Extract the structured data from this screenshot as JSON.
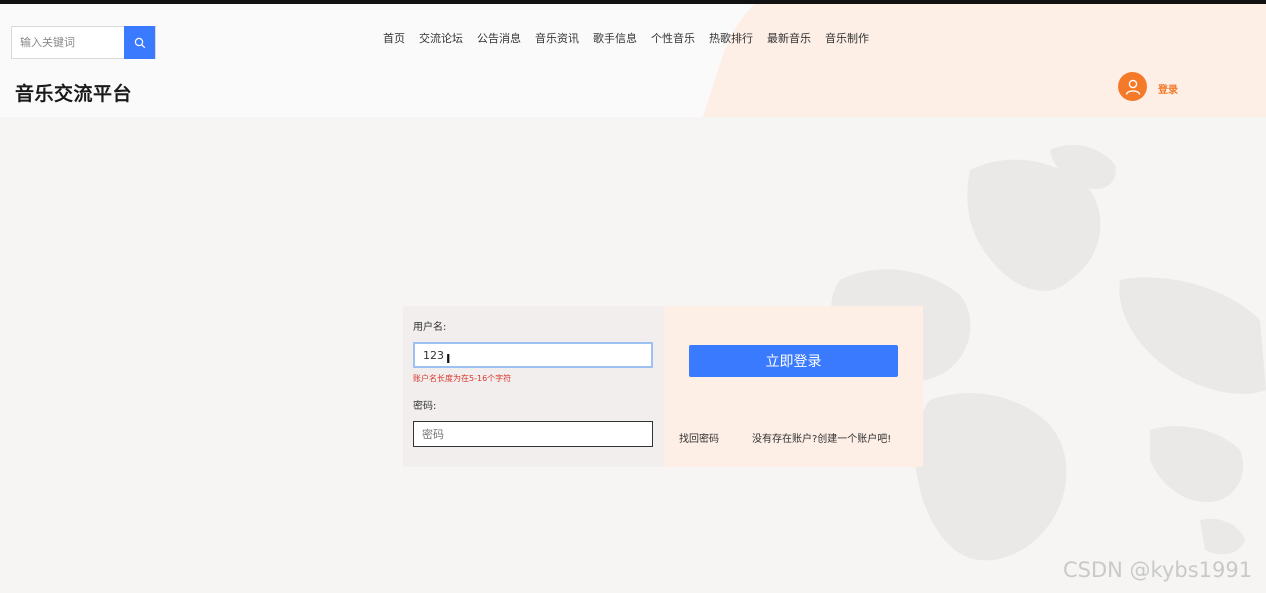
{
  "search": {
    "placeholder": "输入关键词"
  },
  "nav": {
    "items": [
      "首页",
      "交流论坛",
      "公告消息",
      "音乐资讯",
      "歌手信息",
      "个性音乐",
      "热歌排行",
      "最新音乐",
      "音乐制作"
    ]
  },
  "brand": {
    "title": "音乐交流平台"
  },
  "user": {
    "login_label": "登录"
  },
  "login_form": {
    "username_label": "用户名:",
    "username_value": "123",
    "username_error": "账户名长度为在5-16个字符",
    "password_label": "密码:",
    "password_placeholder": "密码",
    "submit_label": "立即登录",
    "forgot_label": "找回密码",
    "register_label": "没有存在账户?创建一个账户吧!"
  },
  "watermark": "CSDN @kybs1991",
  "colors": {
    "accent": "#3a7afe",
    "brand_orange": "#f47a2a",
    "error": "#d9362b",
    "header_deco": "#fdeee6"
  },
  "icons": {
    "search": "search-icon",
    "user": "user-icon",
    "cursor": "text-cursor-icon"
  }
}
